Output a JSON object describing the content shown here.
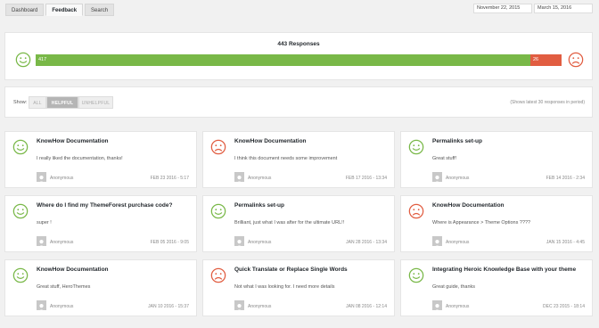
{
  "tabs": [
    {
      "label": "Dashboard",
      "active": false
    },
    {
      "label": "Feedback",
      "active": true
    },
    {
      "label": "Search",
      "active": false
    }
  ],
  "date_range": {
    "from": "November 22, 2015",
    "to": "March 15, 2016"
  },
  "summary": {
    "title": "443 Responses",
    "positive_count": "417",
    "negative_count": "26",
    "positive_fraction": 0.9413,
    "colors": {
      "positive": "#79b848",
      "negative": "#e15d41"
    }
  },
  "filter": {
    "show_label": "Show:",
    "options": [
      "ALL",
      "HELPFUL",
      "UNHELPFUL"
    ],
    "selected": "HELPFUL",
    "info": "(Shows latest 30 responses in period)"
  },
  "cards": [
    {
      "sentiment": "happy",
      "title": "KnowHow Documentation",
      "comment": "I really liked the documentation, thanks!",
      "author": "Anonymous",
      "date": "FEB 23 2016 - 5:17"
    },
    {
      "sentiment": "sad",
      "title": "KnowHow Documentation",
      "comment": "I think this document needs some improvement",
      "author": "Anonymous",
      "date": "FEB 17 2016 - 13:34"
    },
    {
      "sentiment": "happy",
      "title": "Permalinks set-up",
      "comment": "Great stuff!",
      "author": "Anonymous",
      "date": "FEB 14 2016 - 2:34"
    },
    {
      "sentiment": "happy",
      "title": "Where do I find my ThemeForest purchase code?",
      "comment": "super !",
      "author": "Anonymous",
      "date": "FEB 05 2016 - 9:05"
    },
    {
      "sentiment": "happy",
      "title": "Permalinks set-up",
      "comment": "Brilliant, just what I was after for the ultimate URL!!",
      "author": "Anonymous",
      "date": "JAN 28 2016 - 13:34"
    },
    {
      "sentiment": "sad",
      "title": "KnowHow Documentation",
      "comment": "Where is Appearance > Theme Options ????",
      "author": "Anonymous",
      "date": "JAN 15 2016 - 4:45"
    },
    {
      "sentiment": "happy",
      "title": "KnowHow Documentation",
      "comment": "Great stuff, HeroThemes",
      "author": "Anonymous",
      "date": "JAN 10 2016 - 15:37"
    },
    {
      "sentiment": "sad",
      "title": "Quick Translate or Replace Single Words",
      "comment": "Not what I was looking for. I need more details",
      "author": "Anonymous",
      "date": "JAN 08 2016 - 12:14"
    },
    {
      "sentiment": "happy",
      "title": "Integrating Heroic Knowledge Base with your theme",
      "comment": "Great guide, thanks",
      "author": "Anonymous",
      "date": "DEC 23 2015 - 18:14"
    }
  ]
}
